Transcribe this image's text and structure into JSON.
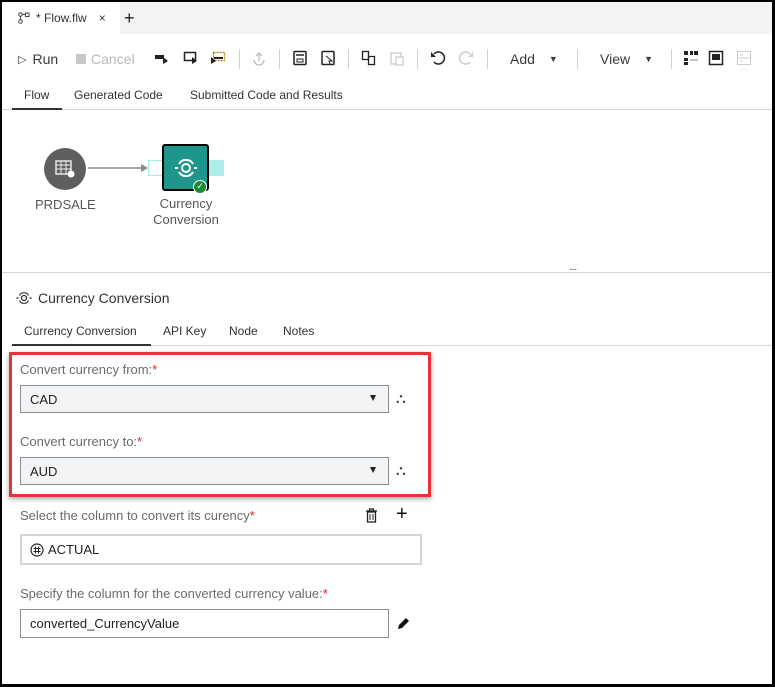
{
  "file_tab": {
    "label": "* Flow.flw",
    "close": "×",
    "new_tab": "+"
  },
  "toolbar": {
    "run": "Run",
    "cancel": "Cancel",
    "add": "Add",
    "view": "View"
  },
  "view_tabs": [
    "Flow",
    "Generated Code",
    "Submitted Code and Results"
  ],
  "canvas": {
    "nodes": [
      {
        "label": "PRDSALE"
      },
      {
        "label_line1": "Currency",
        "label_line2": "Conversion",
        "status": "success"
      }
    ],
    "divider_handle": "...."
  },
  "node_panel": {
    "title": "Currency Conversion",
    "tabs": [
      "Currency Conversion",
      "API Key",
      "Node",
      "Notes"
    ]
  },
  "form": {
    "from_label": "Convert currency from:",
    "from_value": "CAD",
    "to_label": "Convert currency to:",
    "to_value": "AUD",
    "column_label": "Select the column to convert its curency",
    "column_value": "ACTUAL",
    "output_label": "Specify the column for the converted currency value:",
    "output_value": "converted_CurrencyValue",
    "required_mark": "*"
  },
  "colors": {
    "accent": "#1f968b",
    "highlight": "#e8333a",
    "success": "#1a8a2e"
  }
}
